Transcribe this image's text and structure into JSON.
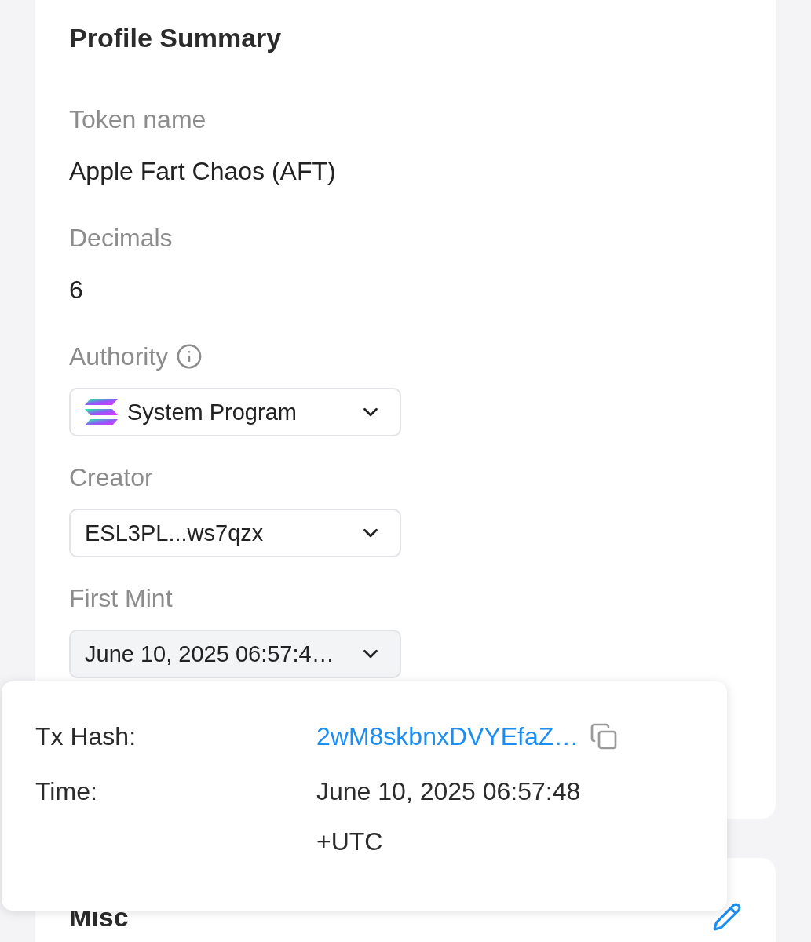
{
  "profile_card": {
    "title": "Profile Summary",
    "fields": [
      {
        "kind": "text",
        "label": "Token name",
        "info": false,
        "value": "Apple Fart Chaos (AFT)"
      },
      {
        "kind": "text",
        "label": "Decimals",
        "info": false,
        "value": "6"
      },
      {
        "kind": "dropdown",
        "label": "Authority",
        "info": true,
        "logo": true,
        "open": false,
        "value": "System Program"
      },
      {
        "kind": "dropdown",
        "label": "Creator",
        "info": false,
        "logo": false,
        "open": false,
        "value": "ESL3PL...ws7qzx"
      },
      {
        "kind": "dropdown",
        "label": "First Mint",
        "info": false,
        "logo": false,
        "open": true,
        "value": "June 10, 2025 06:57:4…"
      }
    ]
  },
  "popover": {
    "rows": [
      {
        "kind": "link",
        "label": "Tx Hash:",
        "value": "2wM8skbnxDVYEfaZ…",
        "copyable": true
      },
      {
        "kind": "text",
        "label": "Time:",
        "value": "June 10, 2025 06:57:48 +UTC",
        "copyable": false
      }
    ]
  },
  "misc_card": {
    "title": "Misc",
    "editable": true
  }
}
